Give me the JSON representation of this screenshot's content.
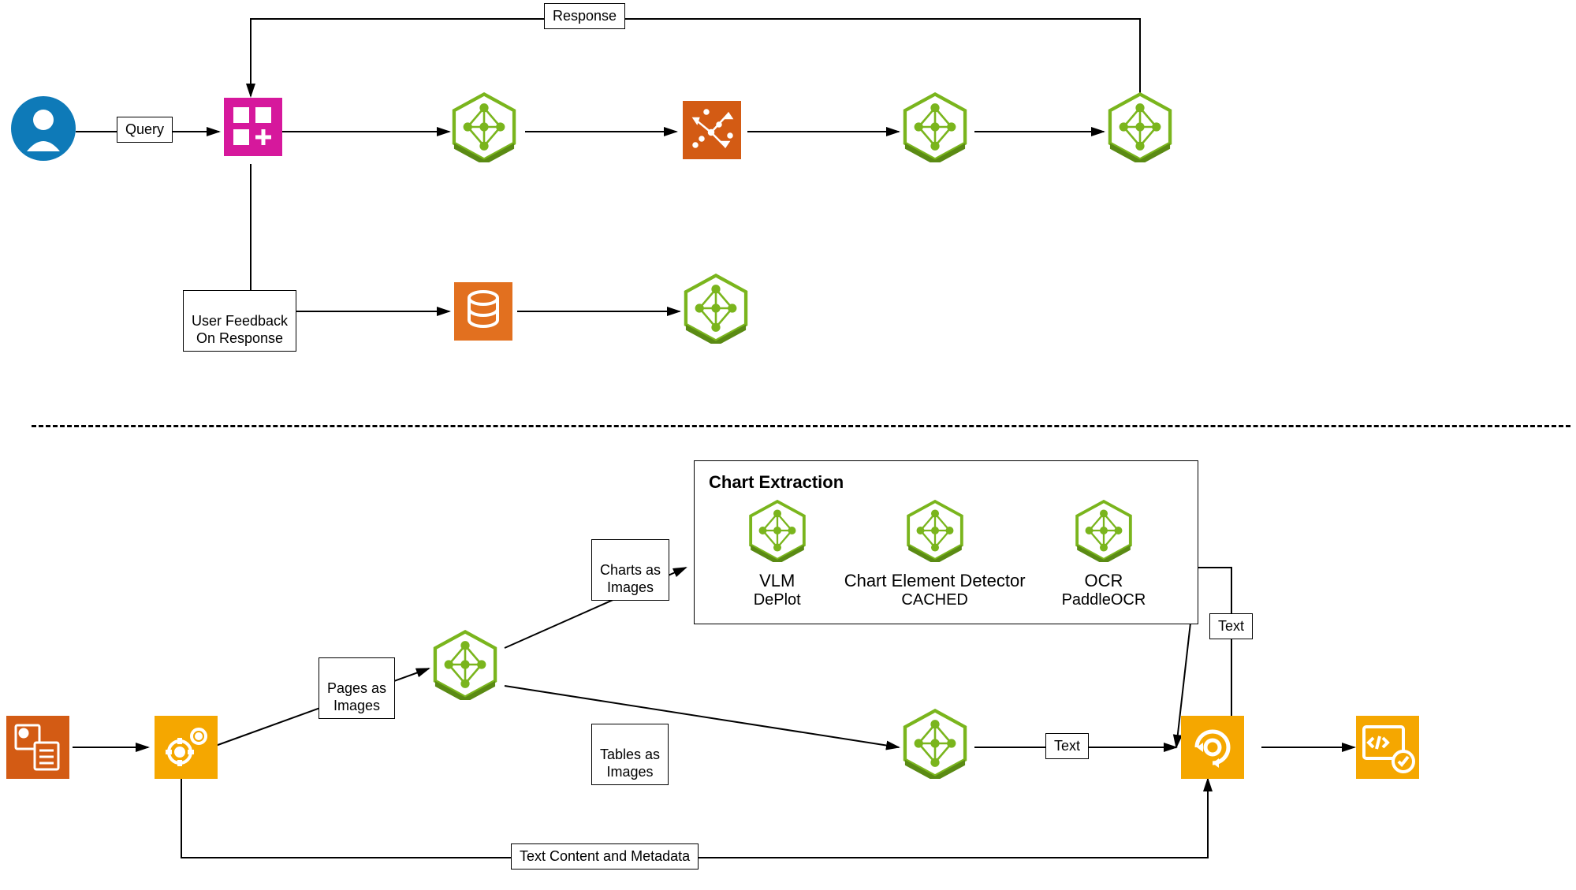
{
  "labels": {
    "response": "Response",
    "query": "Query",
    "userFeedback": "User Feedback\nOn Response",
    "chartExtraction": "Chart Extraction",
    "chartsAsImages": "Charts as\nImages",
    "pagesAsImages": "Pages as\nImages",
    "tablesAsImages": "Tables as\nImages",
    "text1": "Text",
    "text2": "Text",
    "textContentMetadata": "Text Content and Metadata"
  },
  "chartItems": {
    "vlm": {
      "title": "VLM",
      "sub": "DePlot"
    },
    "detector": {
      "title": "Chart Element Detector",
      "sub": "CACHED"
    },
    "ocr": {
      "title": "OCR",
      "sub": "PaddleOCR"
    }
  },
  "colors": {
    "green": "#7ab51d",
    "darkgreen": "#5a8a14",
    "orange": "#e2701f",
    "darkorange": "#d35400",
    "magenta": "#d6189c",
    "blue": "#0e7ab8",
    "amber": "#f5a700"
  }
}
